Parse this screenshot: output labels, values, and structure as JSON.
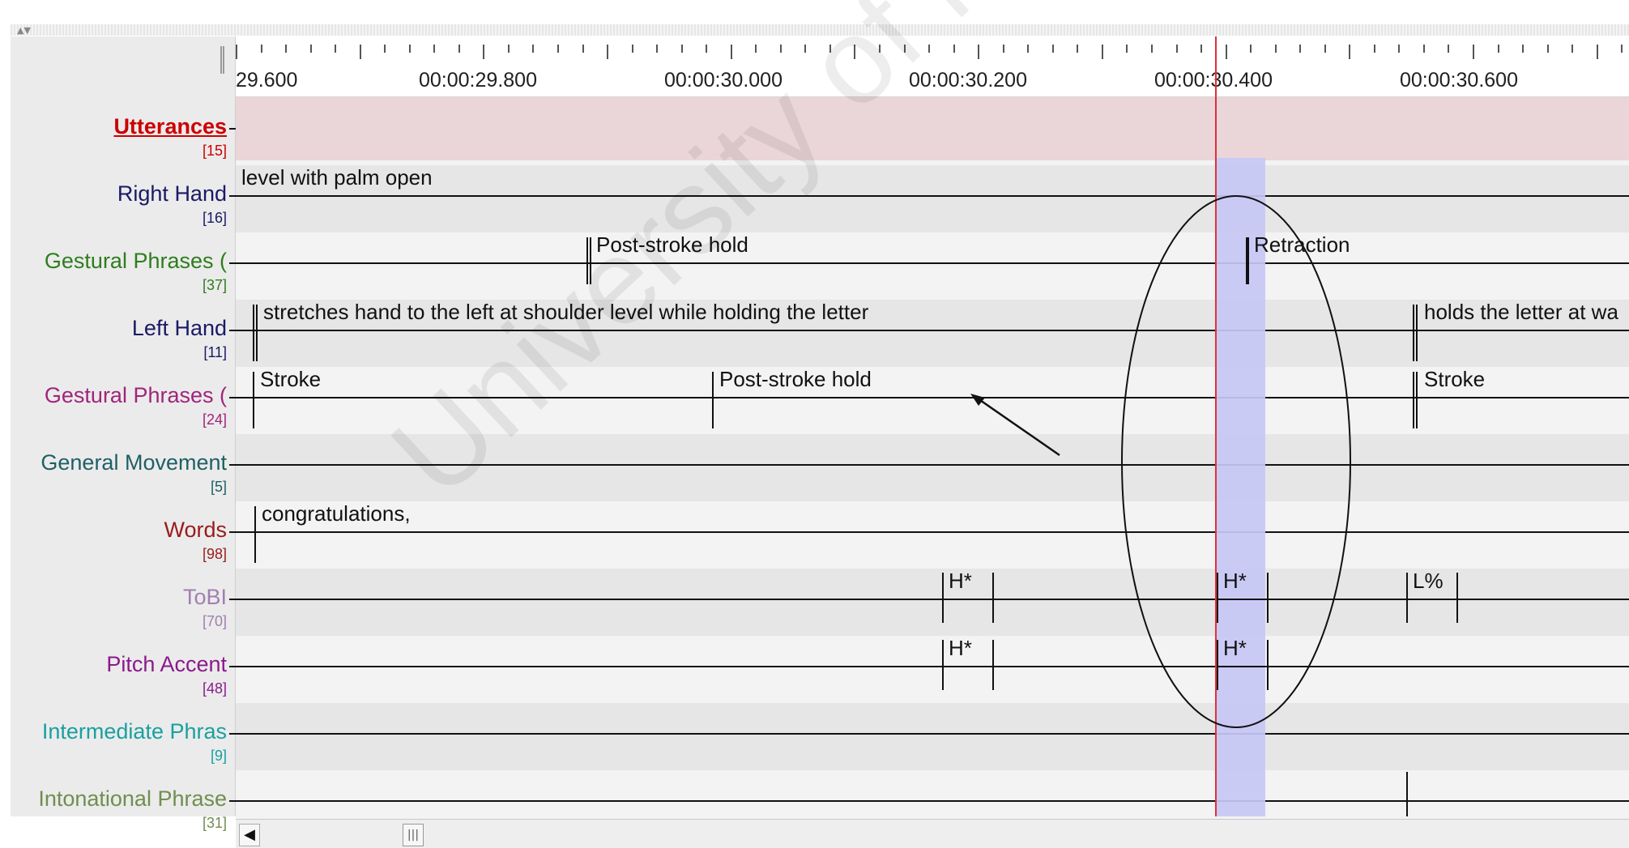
{
  "ruler": {
    "labels": [
      "29.600",
      "00:00:29.800",
      "00:00:30.000",
      "00:00:30.200",
      "00:00:30.400",
      "00:00:30.600"
    ]
  },
  "tiers": [
    {
      "name": "Utterances",
      "count": "[15]",
      "color": "#cc0000"
    },
    {
      "name": "Right Hand",
      "count": "[16]",
      "color": "#1a1a66"
    },
    {
      "name": "Gestural Phrases (",
      "count": "[37]",
      "color": "#2e7d1e"
    },
    {
      "name": "Left Hand",
      "count": "[11]",
      "color": "#1a1a66"
    },
    {
      "name": "Gestural Phrases (",
      "count": "[24]",
      "color": "#a0257a"
    },
    {
      "name": "General Movement",
      "count": "[5]",
      "color": "#1f5f66"
    },
    {
      "name": "Words",
      "count": "[98]",
      "color": "#9a1b1b"
    },
    {
      "name": "ToBI",
      "count": "[70]",
      "color": "#a080b0"
    },
    {
      "name": "Pitch Accent",
      "count": "[48]",
      "color": "#8b1a8b"
    },
    {
      "name": "Intermediate Phras",
      "count": "[9]",
      "color": "#1aa0a0"
    },
    {
      "name": "Intonational Phrase",
      "count": "[31]",
      "color": "#6f8f4f"
    }
  ],
  "annotations": {
    "right_hand": "level with palm open",
    "gestural1_post": "Post-stroke hold",
    "gestural1_retraction": "Retraction",
    "left_hand_1": "stretches hand to the left at shoulder level while holding the letter",
    "left_hand_2": "holds the letter at wa",
    "gestural2_stroke": "Stroke",
    "gestural2_post": "Post-stroke hold",
    "gestural2_stroke2": "Stroke",
    "words_1": "congratulations,",
    "tobi_1": "H*",
    "tobi_2": "H*",
    "tobi_3": "L%",
    "pitch_1": "H*",
    "pitch_2": "H*"
  },
  "watermark": "University of Malaya",
  "colors": {
    "cursor": "#e0303a",
    "selection": "#c7c8f5",
    "utterance_band": "#ead5d9"
  }
}
